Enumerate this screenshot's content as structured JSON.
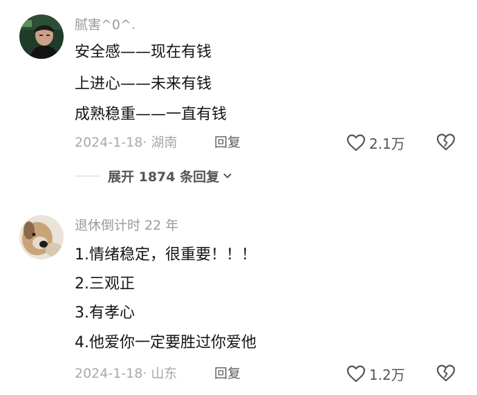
{
  "comments": [
    {
      "username": "腻害^0^.",
      "lines": [
        "安全感——现在有钱",
        "上进心——未来有钱",
        "成熟稳重——一直有钱"
      ],
      "meta": "2024-1-18· 湖南",
      "reply_label": "回复",
      "like_count": "2.1万",
      "expand_label": "展开 1874 条回复"
    },
    {
      "username": "退休倒计时 22 年",
      "lines": [
        "1.情绪稳定，很重要！！！",
        "2.三观正",
        "3.有孝心",
        "4.他爱你一定要胜过你爱他"
      ],
      "meta": "2024-1-18· 山东",
      "reply_label": "回复",
      "like_count": "1.2万"
    }
  ],
  "icons": {
    "like": "heart-outline-icon",
    "dislike": "broken-heart-icon",
    "expand": "chevron-down-icon"
  },
  "colors": {
    "text": "#151515",
    "muted": "#a8a8a8",
    "icon": "#555555"
  }
}
